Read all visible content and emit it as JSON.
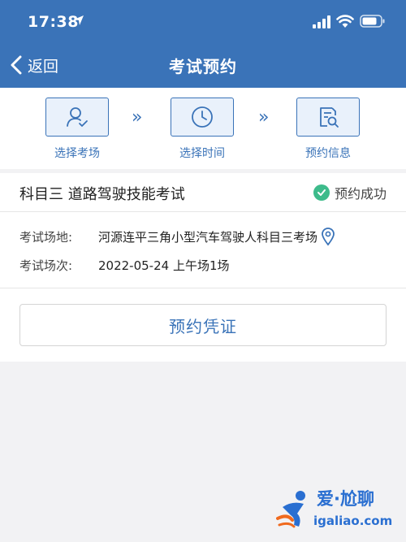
{
  "status_bar": {
    "time": "17:38"
  },
  "nav": {
    "back_label": "返回",
    "title": "考试预约"
  },
  "steps": [
    {
      "label": "选择考场",
      "icon": "user-check-icon"
    },
    {
      "label": "选择时间",
      "icon": "clock-icon"
    },
    {
      "label": "预约信息",
      "icon": "document-search-icon"
    }
  ],
  "card": {
    "title": "科目三 道路驾驶技能考试",
    "status": "预约成功",
    "rows": [
      {
        "label": "考试场地:",
        "value": "河源连平三角小型汽车驾驶人科目三考场"
      },
      {
        "label": "考试场次:",
        "value": "2022-05-24 上午场1场"
      }
    ],
    "voucher_button": "预约凭证"
  },
  "watermark": {
    "top": "爱·尬聊",
    "bottom": "igaliao.com"
  },
  "colors": {
    "primary": "#3a73b8",
    "success": "#3dbb8b",
    "background": "#f2f2f4"
  }
}
